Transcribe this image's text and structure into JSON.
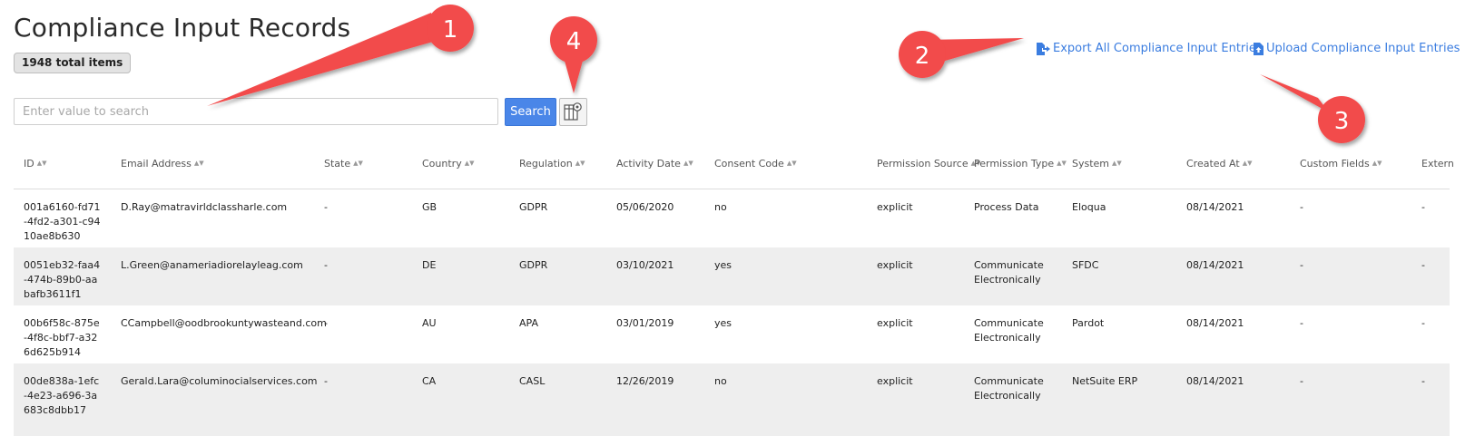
{
  "page": {
    "title": "Compliance Input Records",
    "total_items": "1948 total items"
  },
  "search": {
    "placeholder": "Enter value to search",
    "value": "",
    "button_label": "Search"
  },
  "actions": {
    "export_label": "Export All Compliance Input Entries",
    "upload_label": "Upload Compliance Input Entries"
  },
  "table": {
    "columns": [
      "ID",
      "Email Address",
      "State",
      "Country",
      "Regulation",
      "Activity Date",
      "Consent Code",
      "Permission Source",
      "Permission Type",
      "System",
      "Created At",
      "Custom Fields",
      "Extern"
    ],
    "rows": [
      {
        "id": "001a6160-fd71-4fd2-a301-c9410ae8b630",
        "email": "D.Ray@matravirldclassharle.com",
        "state": "-",
        "country": "GB",
        "regulation": "GDPR",
        "activity_date": "05/06/2020",
        "consent_code": "no",
        "permission_source": "explicit",
        "permission_type": "Process Data",
        "system": "Eloqua",
        "created_at": "08/14/2021",
        "custom_fields": "-",
        "extern": "-"
      },
      {
        "id": "0051eb32-faa4-474b-89b0-aabafb3611f1",
        "email": "L.Green@anameriadiorelayleag.com",
        "state": "-",
        "country": "DE",
        "regulation": "GDPR",
        "activity_date": "03/10/2021",
        "consent_code": "yes",
        "permission_source": "explicit",
        "permission_type": "Communicate Electronically",
        "system": "SFDC",
        "created_at": "08/14/2021",
        "custom_fields": "-",
        "extern": "-"
      },
      {
        "id": "00b6f58c-875e-4f8c-bbf7-a326d625b914",
        "email": "CCampbell@oodbrookuntywasteand.com",
        "state": "-",
        "country": "AU",
        "regulation": "APA",
        "activity_date": "03/01/2019",
        "consent_code": "yes",
        "permission_source": "explicit",
        "permission_type": "Communicate Electronically",
        "system": "Pardot",
        "created_at": "08/14/2021",
        "custom_fields": "-",
        "extern": "-"
      },
      {
        "id": "00de838a-1efc-4e23-a696-3a683c8dbb17",
        "email": "Gerald.Lara@columinocialservices.com",
        "state": "-",
        "country": "CA",
        "regulation": "CASL",
        "activity_date": "12/26/2019",
        "consent_code": "no",
        "permission_source": "explicit",
        "permission_type": "Communicate Electronically",
        "system": "NetSuite ERP",
        "created_at": "08/14/2021",
        "custom_fields": "-",
        "extern": "-"
      }
    ]
  },
  "annotations": [
    {
      "label": "1",
      "color": "#f24b4b"
    },
    {
      "label": "2",
      "color": "#f24b4b"
    },
    {
      "label": "3",
      "color": "#f24b4b"
    },
    {
      "label": "4",
      "color": "#f24b4b"
    }
  ],
  "icons": {
    "export": "file-export-icon",
    "upload": "file-upload-icon",
    "column_settings": "column-settings-icon",
    "sort": "sort-icon"
  },
  "colors": {
    "accent": "#4a86e8",
    "link": "#3b7de0",
    "row_alt": "#eeeeee",
    "annotation": "#f24b4b"
  }
}
